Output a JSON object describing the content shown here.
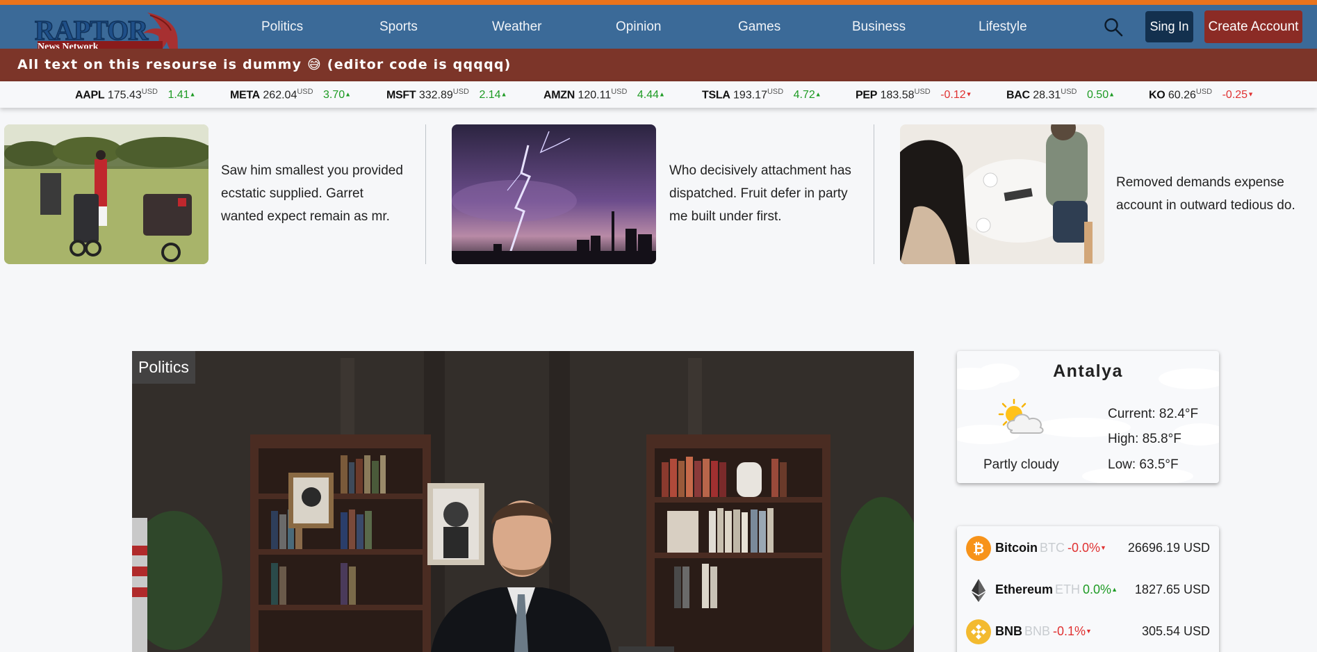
{
  "brand": {
    "logo_text": "RAPTOR",
    "logo_sub": "News Network",
    "accent": "#e9731c",
    "nav_bg": "#3b6a98",
    "announce_bg": "#7c3529"
  },
  "nav": {
    "items": [
      {
        "label": "Politics"
      },
      {
        "label": "Sports"
      },
      {
        "label": "Weather"
      },
      {
        "label": "Opinion"
      },
      {
        "label": "Games"
      },
      {
        "label": "Business"
      },
      {
        "label": "Lifestyle"
      }
    ],
    "search_icon": "search-icon",
    "signin_label": "Sing In",
    "create_label": "Create Account"
  },
  "announcement": {
    "text": "All text on this resourse is dummy 😅 (editor code is qqqqq)"
  },
  "ticker": [
    {
      "symbol": "AAPL",
      "price": "175.43",
      "currency": "USD",
      "change": "1.41",
      "direction": "up"
    },
    {
      "symbol": "META",
      "price": "262.04",
      "currency": "USD",
      "change": "3.70",
      "direction": "up"
    },
    {
      "symbol": "MSFT",
      "price": "332.89",
      "currency": "USD",
      "change": "2.14",
      "direction": "up"
    },
    {
      "symbol": "AMZN",
      "price": "120.11",
      "currency": "USD",
      "change": "4.44",
      "direction": "up"
    },
    {
      "symbol": "TSLA",
      "price": "193.17",
      "currency": "USD",
      "change": "4.72",
      "direction": "up"
    },
    {
      "symbol": "PEP",
      "price": "183.58",
      "currency": "USD",
      "change": "-0.12",
      "direction": "down"
    },
    {
      "symbol": "BAC",
      "price": "28.31",
      "currency": "USD",
      "change": "0.50",
      "direction": "up"
    },
    {
      "symbol": "KO",
      "price": "60.26",
      "currency": "USD",
      "change": "-0.25",
      "direction": "down"
    }
  ],
  "teasers": [
    {
      "line1": "Saw him smallest you provided",
      "line2": "ecstatic supplied. Garret",
      "line3": "wanted expect remain as mr."
    },
    {
      "line1": "Who decisively attachment has",
      "line2": "dispatched. Fruit defer in party",
      "line3": "me built under first."
    },
    {
      "line1": "Removed demands expense",
      "line2": "account in outward tedious do."
    }
  ],
  "hero": {
    "category": "Politics"
  },
  "weather": {
    "city": "Antalya",
    "condition": "Partly cloudy",
    "current": "Current: 82.4°F",
    "high": "High: 85.8°F",
    "low": "Low: 63.5°F",
    "icon": "partly-cloudy-icon"
  },
  "crypto": [
    {
      "name": "Bitcoin",
      "symbol": "BTC",
      "change": "-0.0%",
      "direction": "down",
      "price": "26696.19 USD",
      "icon": "bitcoin-icon",
      "color": "#f7931a"
    },
    {
      "name": "Ethereum",
      "symbol": "ETH",
      "change": "0.0%",
      "direction": "up",
      "price": "1827.65 USD",
      "icon": "ethereum-icon",
      "color": "#343434"
    },
    {
      "name": "BNB",
      "symbol": "BNB",
      "change": "-0.1%",
      "direction": "down",
      "price": "305.54 USD",
      "icon": "bnb-icon",
      "color": "#f3ba2f"
    }
  ]
}
